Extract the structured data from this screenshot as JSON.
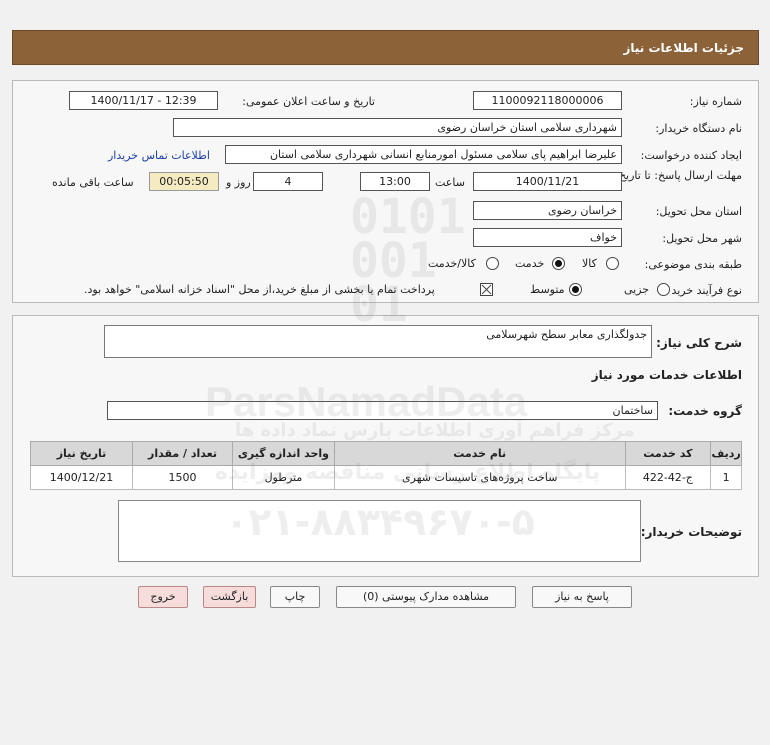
{
  "header": {
    "title": "جزئیات اطلاعات نیاز"
  },
  "form": {
    "need_number_label": "شماره نیاز:",
    "need_number": "1100092118000006",
    "announce_label": "تاریخ و ساعت اعلان عمومی:",
    "announce_value": "1400/11/17 - 12:39",
    "buyer_org_label": "نام دستگاه خریدار:",
    "buyer_org": "شهرداری سلامی استان خراسان رضوی",
    "requester_label": "ایجاد کننده درخواست:",
    "requester": "علیرضا ابراهیم پای سلامی مسئول امورمنابع انسانی  شهرداری سلامی استان",
    "contact_link": "اطلاعات تماس خریدار",
    "deadline_label": "مهلت ارسال پاسخ: تا تاریخ:",
    "deadline_date": "1400/11/21",
    "time_label": "ساعت",
    "deadline_time": "13:00",
    "days_value": "4",
    "days_label": "روز و",
    "remaining_value": "00:05:50",
    "remaining_label": "ساعت باقی مانده",
    "province_label": "استان محل تحویل:",
    "province": "خراسان رضوی",
    "city_label": "شهر محل تحویل:",
    "city": "خواف",
    "category_label": "طبقه بندی موضوعی:",
    "category_options": [
      "کالا",
      "خدمت",
      "کالا/خدمت"
    ],
    "category_selected": "خدمت",
    "process_label": "نوع فرآیند خرید :",
    "process_options": [
      "جزیی",
      "متوسط"
    ],
    "process_selected": "متوسط",
    "payment_note": "پرداخت تمام یا بخشی از مبلغ خرید،از محل \"اسناد خزانه اسلامی\" خواهد بود."
  },
  "details": {
    "summary_label": "شرح کلی نیاز:",
    "summary": "جدولگذاری معابر سطح شهرسلامی",
    "services_heading": "اطلاعات خدمات مورد نیاز",
    "service_group_label": "گروه خدمت:",
    "service_group": "ساختمان",
    "table": {
      "headers": [
        "ردیف",
        "کد خدمت",
        "نام خدمت",
        "واحد اندازه گیری",
        "تعداد / مقدار",
        "تاریخ نیاز"
      ],
      "rows": [
        [
          "1",
          "ج-42-422",
          "ساخت پروژه‌های تاسیسات شهری",
          "مترطول",
          "1500",
          "1400/12/21"
        ]
      ]
    },
    "buyer_notes_label": "توضیحات خریدار:",
    "buyer_notes": ""
  },
  "buttons": {
    "reply": "پاسخ به نیاز",
    "attachments": "مشاهده مدارک پیوستی (0)",
    "print": "چاپ",
    "back": "بازگشت",
    "exit": "خروج"
  },
  "watermark": {
    "brand": "ParsNamadData",
    "line1": "مرکز فراهم آوری اطلاعات پارس نماد داده ها",
    "line2": "پایگاه اطلاع رسانی مناقصه ومزایده",
    "phone": "۰۲۱-۸۸۳۴۹۶۷۰-۵"
  },
  "colors": {
    "header_bg": "#8c6239",
    "link": "#1a3fa8",
    "pink_button": "#f7dcdc"
  }
}
